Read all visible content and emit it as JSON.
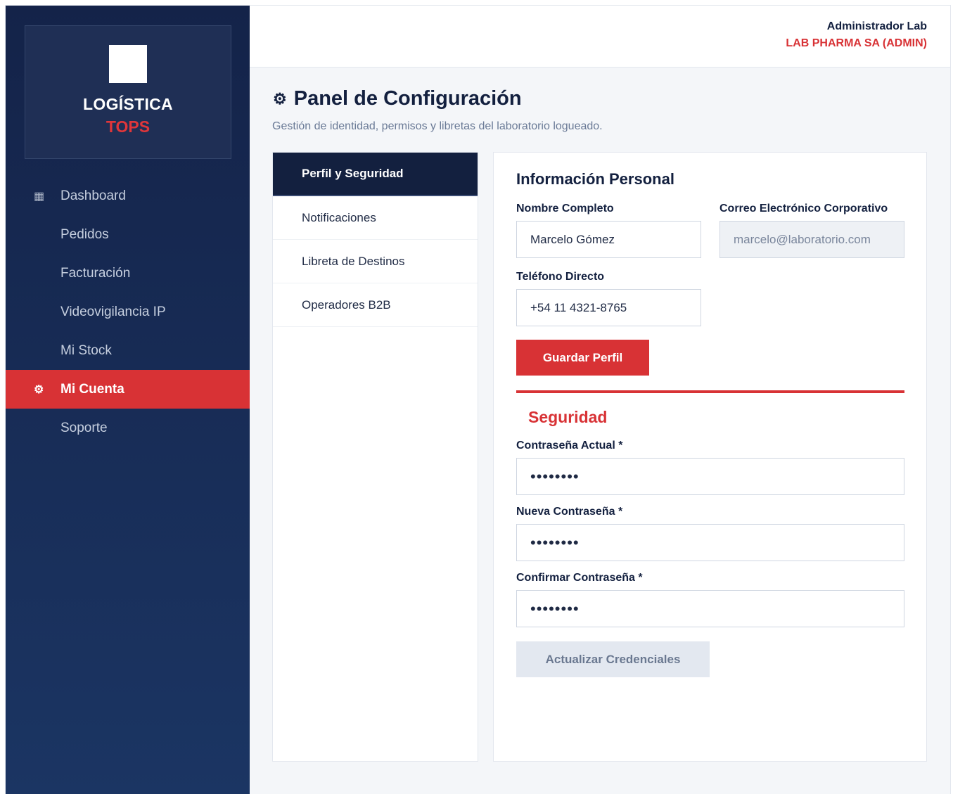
{
  "brand": {
    "line1": "LOGÍSTICA",
    "line2": "TOPS"
  },
  "sidebar": {
    "items": [
      {
        "label": "Dashboard",
        "icon": "grid-icon",
        "glyph": "▦"
      },
      {
        "label": "Pedidos",
        "icon": "",
        "glyph": ""
      },
      {
        "label": "Facturación",
        "icon": "",
        "glyph": ""
      },
      {
        "label": "Videovigilancia IP",
        "icon": "",
        "glyph": ""
      },
      {
        "label": "Mi Stock",
        "icon": "",
        "glyph": ""
      },
      {
        "label": "Mi Cuenta",
        "icon": "gear-icon",
        "glyph": "⚙",
        "active": true
      },
      {
        "label": "Soporte",
        "icon": "",
        "glyph": ""
      }
    ]
  },
  "header": {
    "user_name": "Administrador Lab",
    "organization": "LAB PHARMA SA (ADMIN)"
  },
  "page": {
    "title_icon": "⚙",
    "title": "Panel de Configuración",
    "subtitle": "Gestión de identidad, permisos y libretas del laboratorio logueado."
  },
  "tabs": [
    {
      "label": "Perfil y Seguridad",
      "active": true
    },
    {
      "label": "Notificaciones"
    },
    {
      "label": "Libreta de Destinos"
    },
    {
      "label": "Operadores B2B"
    }
  ],
  "profile": {
    "section_title": "Información Personal",
    "name_label": "Nombre Completo",
    "name_value": "Marcelo Gómez",
    "email_label": "Correo Electrónico Corporativo",
    "email_value": "marcelo@laboratorio.com",
    "phone_label": "Teléfono Directo",
    "phone_value": "+54 11 4321-8765",
    "save_label": "Guardar Perfil"
  },
  "security": {
    "section_title": "Seguridad",
    "current_label": "Contraseña Actual *",
    "current_value": "••••••••",
    "new_label": "Nueva Contraseña *",
    "new_value": "••••••••",
    "confirm_label": "Confirmar Contraseña *",
    "confirm_value": "••••••••",
    "update_label": "Actualizar Credenciales"
  },
  "colors": {
    "sidebar_top": "#142349",
    "sidebar_bottom": "#1b3563",
    "accent": "#d83235",
    "navy": "#13203f"
  }
}
